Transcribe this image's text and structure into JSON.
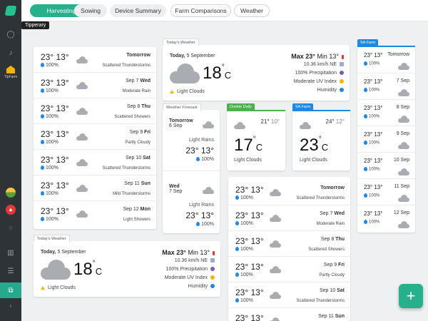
{
  "sidebar": {
    "tooltip": "Tipperary",
    "farm_label": "TipFarm"
  },
  "tabs": [
    {
      "label": "Harvesting"
    },
    {
      "label": "Sowing"
    },
    {
      "label": "Device Summary"
    },
    {
      "label": "Farm Comparisons"
    },
    {
      "label": "Weather"
    }
  ],
  "forecast_left": [
    {
      "max": "23°",
      "min": "13°",
      "precip": "100%",
      "day": "Tomorrow",
      "date": "",
      "cond": "Scattered Thunderstorms"
    },
    {
      "max": "23°",
      "min": "13°",
      "precip": "100%",
      "day": "Wed",
      "date": "Sep 7",
      "cond": "Moderate Rain"
    },
    {
      "max": "23°",
      "min": "13°",
      "precip": "100%",
      "day": "Thu",
      "date": "Sep 8",
      "cond": "Scattered Showers"
    },
    {
      "max": "23°",
      "min": "13°",
      "precip": "100%",
      "day": "Fri",
      "date": "Sep 9",
      "cond": "Partly Cloudy"
    },
    {
      "max": "23°",
      "min": "13°",
      "precip": "100%",
      "day": "Sat",
      "date": "Sep 10",
      "cond": "Scattered Thunderstorms"
    },
    {
      "max": "23°",
      "min": "13°",
      "precip": "100%",
      "day": "Sun",
      "date": "Sep 11",
      "cond": "Mild Thunderstorms"
    },
    {
      "max": "23°",
      "min": "13°",
      "precip": "100%",
      "day": "Mon",
      "date": "Sep 12",
      "cond": "Light Showers"
    }
  ],
  "today_top": {
    "tag": "Today's Weather",
    "day": "Today,",
    "date": "5 September",
    "temp": "18",
    "deg": "°",
    "unit": "C",
    "cond": "Light Clouds",
    "max": "Max 23°",
    "min": "Min 13°",
    "wind": "10.36 km/h NE",
    "precip": "100% Precipitation",
    "uv": "Moderate UV Index",
    "humidity": "Humidity"
  },
  "today_bottom": {
    "tag": "Today's Weather",
    "day": "Today,",
    "date": "5 September",
    "temp": "18",
    "deg": "°",
    "unit": "C",
    "cond": "Light Clouds",
    "max": "Max 23°",
    "min": "Min 13°",
    "wind": "10.36 km/h NE",
    "precip": "100% Precipitation",
    "uv": "Moderate UV Index",
    "humidity": "Humidity"
  },
  "weather_forecast": {
    "tag": "Weather Forecast",
    "days": [
      {
        "day": "Tomorrow",
        "date": "6 Sep",
        "cond": "Light Rains",
        "max": "23°",
        "min": "13°",
        "precip": "100%"
      },
      {
        "day": "Wed",
        "date": "7 Sep",
        "cond": "Light Rains",
        "max": "23°",
        "min": "13°",
        "precip": "100%"
      }
    ]
  },
  "dookie": {
    "tag": "Dookie Daily",
    "max": "21°",
    "min": "10°",
    "temp": "17",
    "deg": "°",
    "unit": "C",
    "cond": "Light Clouds"
  },
  "sa_farm_small": {
    "tag": "SA Farm",
    "max": "24°",
    "min": "12°",
    "temp": "23",
    "deg": "°",
    "unit": "C",
    "cond": "Light Clouds"
  },
  "forecast_middle": [
    {
      "max": "23°",
      "min": "13°",
      "precip": "100%",
      "day": "Tomorrow",
      "date": "",
      "cond": "Scattered Thunderstorms"
    },
    {
      "max": "23°",
      "min": "13°",
      "precip": "100%",
      "day": "Wed",
      "date": "Sep 7",
      "cond": "Moderate Rain"
    },
    {
      "max": "23°",
      "min": "13°",
      "precip": "100%",
      "day": "Thu",
      "date": "Sep 8",
      "cond": "Scattered Showers"
    },
    {
      "max": "23°",
      "min": "13°",
      "precip": "100%",
      "day": "Fri",
      "date": "Sep 9",
      "cond": "Partly Cloudy"
    },
    {
      "max": "23°",
      "min": "13°",
      "precip": "100%",
      "day": "Sat",
      "date": "Sep 10",
      "cond": "Scattered Thunderstorms"
    },
    {
      "max": "23°",
      "min": "13°",
      "precip": "",
      "day": "Sun",
      "date": "Sep 11",
      "cond": ""
    }
  ],
  "sa_farm_list": {
    "tag": "SA Farm",
    "rows": [
      {
        "temp": "23° 13°",
        "date": "Tomorrow",
        "precip": "100%"
      },
      {
        "temp": "23° 13°",
        "date": "7 Sep",
        "precip": "100%"
      },
      {
        "temp": "23° 13°",
        "date": "8 Sep",
        "precip": "100%"
      },
      {
        "temp": "23° 13°",
        "date": "9 Sep",
        "precip": "100%"
      },
      {
        "temp": "23° 13°",
        "date": "10 Sep",
        "precip": "100%"
      },
      {
        "temp": "23° 13°",
        "date": "11 Sep",
        "precip": "100%"
      },
      {
        "temp": "23° 13°",
        "date": "12 Sep",
        "precip": "100%"
      }
    ]
  },
  "fab_label": "+",
  "colors": {
    "accent": "#27b08c",
    "sidebar": "#2e3338",
    "blue": "#1e88e5",
    "green": "#4caf50",
    "warn": "#f4b400"
  }
}
